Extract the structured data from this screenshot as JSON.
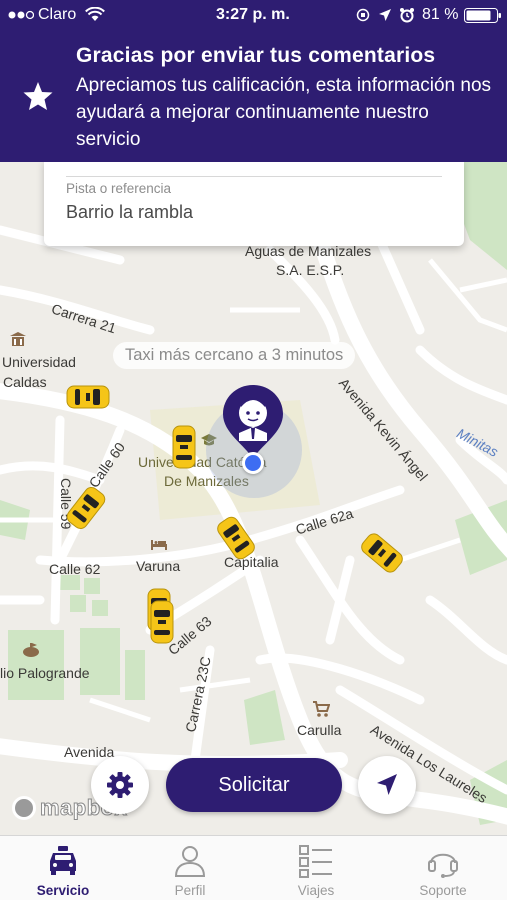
{
  "status_bar": {
    "carrier": "Claro",
    "time": "3:27 p. m.",
    "battery": "81 %"
  },
  "banner": {
    "title": "Gracias por enviar tus comentarios",
    "message": "Apreciamos tus calificación, esta información nos ayudará a mejorar continuamente nuestro servicio",
    "icon": "star-icon"
  },
  "address_card": {
    "ref_label": "Pista o referencia",
    "ref_value": "Barrio la rambla"
  },
  "map": {
    "eta_text": "Taxi más cercano a 3 minutos",
    "labels": {
      "aguas_1": "Aguas de Manizales",
      "aguas_2": "S.A. E.S.P.",
      "carrera21": "Carrera 21",
      "universidad": "Universidad",
      "caldas": "Caldas",
      "avenida_kevin": "Avenida Kevin Ángel",
      "minitas": "Minitas",
      "calle59": "Calle 59",
      "calle60": "Calle 60",
      "catolica_1": "Universidad Católica",
      "catolica_2": "De Manizales",
      "calle62a": "Calle 62a",
      "capitalia": "Capitalia",
      "varuna": "Varuna",
      "calle62": "Calle 62",
      "calle63": "Calle 63",
      "carrera23c": "Carrera 23C",
      "palogrande": "lio Palogrande",
      "carulla": "Carulla",
      "avenida_laureles": "Avenida Los Laureles",
      "avenida_bottom": "Avenida"
    },
    "attribution": "mapbox"
  },
  "actions": {
    "request_label": "Solicitar",
    "settings_icon": "gear-icon",
    "locate_icon": "navigation-arrow-icon"
  },
  "tabs": [
    {
      "label": "Servicio",
      "icon": "taxi-icon",
      "active": true
    },
    {
      "label": "Perfil",
      "icon": "user-icon",
      "active": false
    },
    {
      "label": "Viajes",
      "icon": "list-icon",
      "active": false
    },
    {
      "label": "Soporte",
      "icon": "headset-icon",
      "active": false
    }
  ],
  "colors": {
    "brand": "#2e1d72",
    "taxi": "#f5c518",
    "location": "#3d6df2"
  }
}
